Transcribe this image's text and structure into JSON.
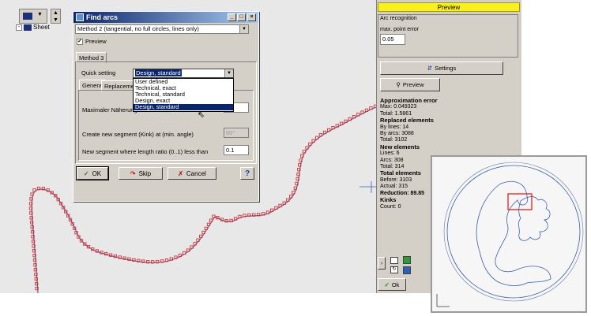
{
  "toolbar": {
    "view_icon": "grid-view-icon",
    "spinner_icon": "updown-icon"
  },
  "tree": {
    "toggle": "-",
    "root_label": "Sheet"
  },
  "dialog": {
    "title": "Find arcs",
    "method_select": "Method 2 (tangential, no full circles, lines only)",
    "preview_label": "Preview",
    "preview_checked": "✓",
    "tab_method": "Method 3",
    "quick_setting_label": "Quick setting",
    "quick_setting_value": "Design, standard",
    "dropdown_options": [
      "User defined",
      "Technical, exact",
      "Technical, standard",
      "Design, exact",
      "Design, standard"
    ],
    "subtab_general": "General",
    "subtab_replacement": "Replaceme",
    "max_error_label": "Maximaler Näherungs",
    "kink_label": "Create new segment (Kink) at (min. angle)",
    "kink_value": "60°",
    "ratio_label": "New segment where length ratio (0..1) less than",
    "ratio_value": "0.1",
    "ok_label": "OK",
    "skip_label": "Skip",
    "cancel_label": "Cancel",
    "help_label": "?"
  },
  "panel": {
    "title": "Preview",
    "group_title": "Arc recognition",
    "max_point_error_label": "max. point error",
    "max_point_error_value": "0.05",
    "settings_label": "Settings",
    "preview_button_label": "Preview",
    "approx_header": "Approximation error",
    "approx_max": "Max: 0.049323",
    "approx_total": "Total: 1.5861",
    "replaced_header": "Replaced elements",
    "replaced_lines": "By lines: 14",
    "replaced_arcs": "By arcs: 3088",
    "replaced_total": "Total: 3102",
    "new_header": "New elements",
    "new_lines": "Lines: 6",
    "new_arcs": "Arcs: 308",
    "new_total": "Total: 314",
    "total_header": "Total elements",
    "total_before": "Before: 3103",
    "total_actual": "Actual: 315",
    "reduction": "Reduction: 89.85",
    "kinks_header": "Kinks",
    "kinks_count": "Count: 0",
    "ok_label": "Ok"
  },
  "colors": {
    "curve": "#3a5faa",
    "markers": "#e03030",
    "selection_box": "#e02020",
    "title_active": "#0a246a",
    "panel_title": "#f8f020"
  }
}
